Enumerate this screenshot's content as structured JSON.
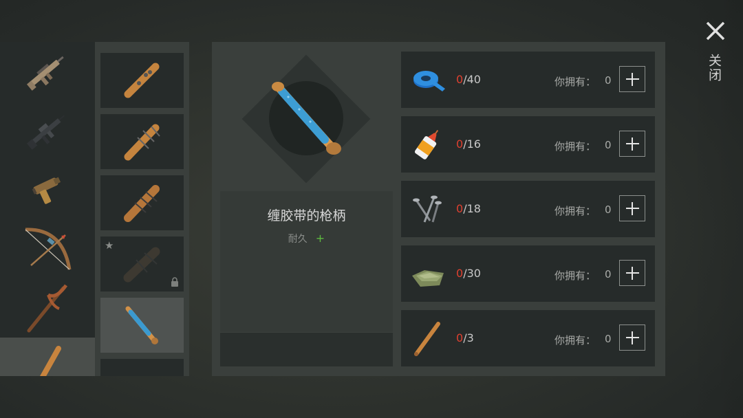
{
  "close": {
    "label": "关闭"
  },
  "categories": [
    {
      "name": "assault-rifle"
    },
    {
      "name": "m16-rifle"
    },
    {
      "name": "flare-pistol"
    },
    {
      "name": "bow"
    },
    {
      "name": "pickaxe"
    },
    {
      "name": "baseball-bat"
    }
  ],
  "recipes": [
    {
      "name": "bat-with-studs"
    },
    {
      "name": "bat-with-spikes"
    },
    {
      "name": "bat-with-nails"
    },
    {
      "name": "spiked-club",
      "locked": true,
      "starred": true
    },
    {
      "name": "taped-bat",
      "selected": true
    },
    {
      "name": "bat-partial"
    }
  ],
  "selected_item": {
    "name": "缠胶带的枪柄",
    "durability_label": "耐久",
    "durability_plus": "+"
  },
  "requirements": [
    {
      "icon": "tape-roll-icon",
      "have": "0",
      "need": "/40",
      "owned_label": "你拥有：",
      "owned": "0"
    },
    {
      "icon": "glue-bottle-icon",
      "have": "0",
      "need": "/16",
      "owned_label": "你拥有：",
      "owned": "0"
    },
    {
      "icon": "nails-icon",
      "have": "0",
      "need": "/18",
      "owned_label": "你拥有：",
      "owned": "0"
    },
    {
      "icon": "cloth-icon",
      "have": "0",
      "need": "/30",
      "owned_label": "你拥有：",
      "owned": "0"
    },
    {
      "icon": "baseball-bat-icon",
      "have": "0",
      "need": "/3",
      "owned_label": "你拥有：",
      "owned": "0"
    }
  ],
  "colors": {
    "missing": "#e0402f",
    "durability_plus": "#5dbb3f",
    "tape_blue": "#2f8fd0",
    "wood": "#c07d3a"
  }
}
